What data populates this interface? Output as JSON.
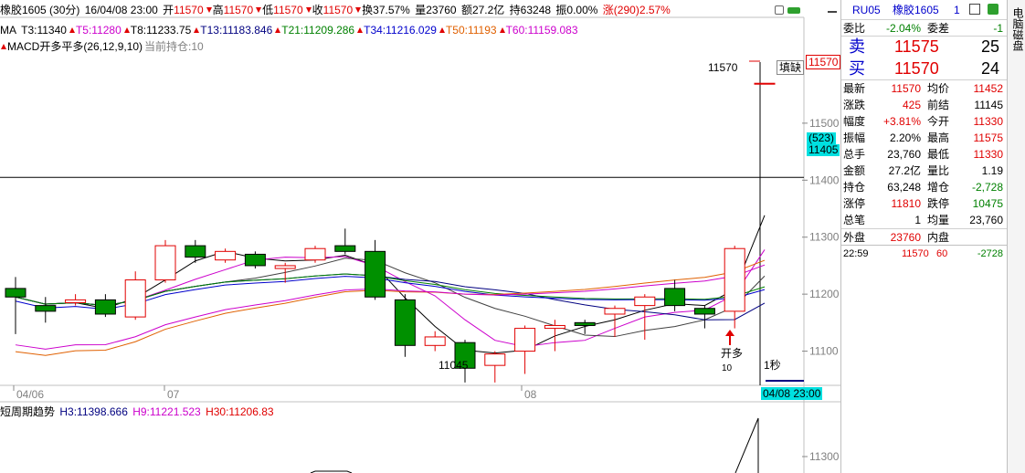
{
  "header": {
    "symbol_label": "橡胶1605 (30分)",
    "datetime": "16/04/08 23:00",
    "open_label": "开",
    "open": "11570",
    "high_label": "高",
    "high": "11570",
    "low_label": "低",
    "low": "11570",
    "close_label": "收",
    "close": "11570",
    "turnover_label": "换",
    "turnover": "37.57%",
    "volume_label": "量",
    "volume": "23760",
    "amount_label": "额",
    "amount": "27.2亿",
    "oi_label": "持",
    "oi": "63248",
    "amp_label": "振",
    "amp": "0.00%",
    "change_label": "涨",
    "change": "(290)",
    "change_pct": "2.57%"
  },
  "ma_line": {
    "label": "MA",
    "items": [
      {
        "text": "T3:11340",
        "color": "#000000"
      },
      {
        "text": "T5:11280",
        "color": "#cc00cc"
      },
      {
        "text": "T8:11233.75",
        "color": "#000000"
      },
      {
        "text": "T13:11183.846",
        "color": "#000080"
      },
      {
        "text": "T21:11209.286",
        "color": "#008000"
      },
      {
        "text": "T34:11216.029",
        "color": "#0000cc"
      },
      {
        "text": "T50:11193",
        "color": "#e06000"
      },
      {
        "text": "T60:11159.083",
        "color": "#cc00cc"
      }
    ]
  },
  "macd_line": {
    "label": "MACD开多平多(26,12,9,10)",
    "position": "当前持仓:10"
  },
  "chart_labels": {
    "price_tag": "11570",
    "fill_gap": "填缺",
    "price_box": "11570",
    "crosshair_count": "(523)",
    "crosshair_price": "11405",
    "low_label": "11045",
    "signal": "开多",
    "signal_qty": "10",
    "timer": "1秒",
    "cursor_time": "04/08 23:00"
  },
  "chart_data": {
    "type": "candlestick",
    "ylim": [
      11040,
      11620
    ],
    "y_ticks": [
      11100,
      11200,
      11300,
      11400,
      11500
    ],
    "x_ticks": [
      "04/06",
      "07",
      "08"
    ],
    "candles": [
      {
        "o": 11210,
        "h": 11230,
        "l": 11130,
        "c": 11195
      },
      {
        "o": 11180,
        "h": 11195,
        "l": 11150,
        "c": 11170
      },
      {
        "o": 11185,
        "h": 11200,
        "l": 11180,
        "c": 11190
      },
      {
        "o": 11190,
        "h": 11200,
        "l": 11160,
        "c": 11165
      },
      {
        "o": 11160,
        "h": 11240,
        "l": 11155,
        "c": 11225
      },
      {
        "o": 11225,
        "h": 11295,
        "l": 11220,
        "c": 11285
      },
      {
        "o": 11285,
        "h": 11295,
        "l": 11255,
        "c": 11265
      },
      {
        "o": 11260,
        "h": 11280,
        "l": 11255,
        "c": 11275
      },
      {
        "o": 11270,
        "h": 11275,
        "l": 11245,
        "c": 11250
      },
      {
        "o": 11245,
        "h": 11255,
        "l": 11220,
        "c": 11250
      },
      {
        "o": 11260,
        "h": 11285,
        "l": 11255,
        "c": 11280
      },
      {
        "o": 11285,
        "h": 11315,
        "l": 11270,
        "c": 11275
      },
      {
        "o": 11275,
        "h": 11295,
        "l": 11190,
        "c": 11195
      },
      {
        "o": 11190,
        "h": 11200,
        "l": 11090,
        "c": 11110
      },
      {
        "o": 11110,
        "h": 11135,
        "l": 11100,
        "c": 11125
      },
      {
        "o": 11115,
        "h": 11120,
        "l": 11045,
        "c": 11070
      },
      {
        "o": 11075,
        "h": 11100,
        "l": 11045,
        "c": 11095
      },
      {
        "o": 11100,
        "h": 11145,
        "l": 11060,
        "c": 11140
      },
      {
        "o": 11140,
        "h": 11155,
        "l": 11100,
        "c": 11145
      },
      {
        "o": 11150,
        "h": 11155,
        "l": 11130,
        "c": 11145
      },
      {
        "o": 11165,
        "h": 11180,
        "l": 11125,
        "c": 11175
      },
      {
        "o": 11180,
        "h": 11200,
        "l": 11120,
        "c": 11195
      },
      {
        "o": 11210,
        "h": 11225,
        "l": 11170,
        "c": 11180
      },
      {
        "o": 11175,
        "h": 11180,
        "l": 11140,
        "c": 11165
      },
      {
        "o": 11170,
        "h": 11285,
        "l": 11140,
        "c": 11280
      },
      {
        "o": 11570,
        "h": 11570,
        "l": 11570,
        "c": 11570
      }
    ]
  },
  "lower": {
    "title": "短周期趋势",
    "h3": "H3:11398.666",
    "h9": "H9:11221.523",
    "h30": "H30:11206.83",
    "tick": "11300"
  },
  "panel": {
    "code": "RU05",
    "name": "橡胶1605",
    "num": "1",
    "rows": [
      {
        "l": "委比",
        "v": "-2.04%",
        "l2": "委差",
        "v2": "-1"
      },
      {
        "l": "最新",
        "v": "11570",
        "l2": "均价",
        "v2": "11452"
      },
      {
        "l": "涨跌",
        "v": "425",
        "l2": "前结",
        "v2": "11145"
      },
      {
        "l": "幅度",
        "v": "+3.81%",
        "l2": "今开",
        "v2": "11330"
      },
      {
        "l": "振幅",
        "v": "2.20%",
        "l2": "最高",
        "v2": "11575"
      },
      {
        "l": "总手",
        "v": "23,760",
        "l2": "最低",
        "v2": "11330"
      },
      {
        "l": "金额",
        "v": "27.2亿",
        "l2": "量比",
        "v2": "1.19"
      },
      {
        "l": "持仓",
        "v": "63,248",
        "l2": "增仓",
        "v2": "-2,728"
      },
      {
        "l": "涨停",
        "v": "11810",
        "l2": "跌停",
        "v2": "10475"
      },
      {
        "l": "总笔",
        "v": "1",
        "l2": "均量",
        "v2": "23,760"
      },
      {
        "l": "外盘",
        "v": "23760",
        "l2": "内盘",
        "v2": ""
      }
    ],
    "sell_label": "卖",
    "sell_price": "11575",
    "sell_qty": "25",
    "buy_label": "买",
    "buy_price": "11570",
    "buy_qty": "24",
    "tick_time": "22:59",
    "tick_price": "11570",
    "tick_vol": "60",
    "tick_oi": "-2728"
  },
  "sidebar": {
    "label": "电脑磁盘"
  }
}
